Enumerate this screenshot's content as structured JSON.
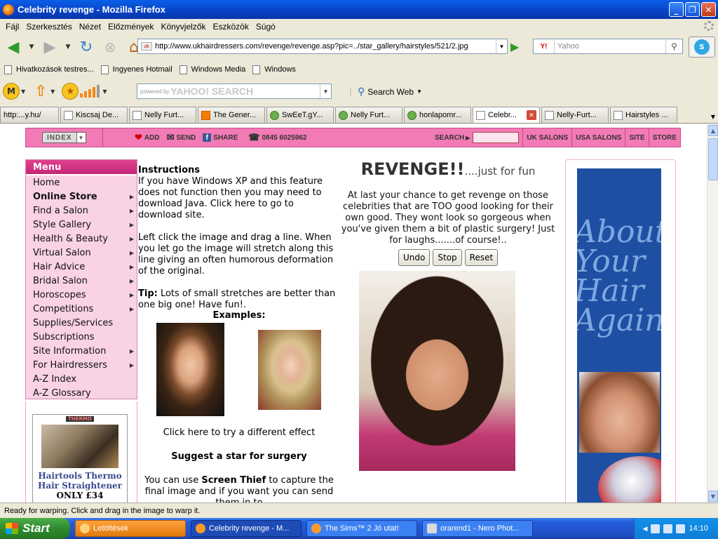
{
  "window": {
    "title": "Celebrity revenge - Mozilla Firefox",
    "buttons": [
      "_",
      "❐",
      "✕"
    ]
  },
  "menubar": {
    "items": [
      "Fájl",
      "Szerkesztés",
      "Nézet",
      "Előzmények",
      "Könyvjelzők",
      "Eszközök",
      "Súgó"
    ]
  },
  "navbar": {
    "url": "http://www.ukhairdressers.com/revenge/revenge.asp?pic=../star_gallery/hairstyles/521/2.jpg",
    "search_placeholder": "Yahoo",
    "search_engine": "Y!"
  },
  "bookmarks": [
    "Hivatkozások testres...",
    "Ingyenes Hotmail",
    "Windows Media",
    "Windows"
  ],
  "yahoo_toolbar": {
    "search_prefix": "powered by",
    "search_logo": "YAHOO! SEARCH",
    "search_web_label": "Search Web"
  },
  "tabs": [
    {
      "label": "http:...y.hu/",
      "icon": "page"
    },
    {
      "label": "Kiscsaj De...",
      "icon": "page"
    },
    {
      "label": "Nelly Furt...",
      "icon": "page"
    },
    {
      "label": "The Gener...",
      "icon": "blogger"
    },
    {
      "label": "SwEeT.gY...",
      "icon": "flower"
    },
    {
      "label": "Nelly Furt...",
      "icon": "flower"
    },
    {
      "label": "honlapomr...",
      "icon": "flower"
    },
    {
      "label": "Celebr...",
      "icon": "page",
      "active": true
    },
    {
      "label": "Nelly-Furt...",
      "icon": "page"
    },
    {
      "label": "Hairstyles ...",
      "icon": "page"
    }
  ],
  "site_nav": {
    "index_label": "INDEX",
    "add": "ADD",
    "send": "SEND",
    "share": "SHARE",
    "phone": "0845 6025962",
    "search_label": "SEARCH",
    "links": [
      "UK SALONS",
      "USA SALONS",
      "SITE",
      "STORE"
    ]
  },
  "menu": {
    "header": "Menu",
    "items": [
      {
        "label": "Home",
        "arrow": false,
        "bold": false
      },
      {
        "label": "Online Store",
        "arrow": true,
        "bold": true
      },
      {
        "label": "Find a Salon",
        "arrow": true,
        "bold": false
      },
      {
        "label": "Style Gallery",
        "arrow": true,
        "bold": false
      },
      {
        "label": "Health & Beauty",
        "arrow": true,
        "bold": false
      },
      {
        "label": "Virtual Salon",
        "arrow": true,
        "bold": false
      },
      {
        "label": "Hair Advice",
        "arrow": true,
        "bold": false
      },
      {
        "label": "Bridal Salon",
        "arrow": true,
        "bold": false
      },
      {
        "label": "Horoscopes",
        "arrow": true,
        "bold": false
      },
      {
        "label": "Competitions",
        "arrow": true,
        "bold": false
      },
      {
        "label": "Supplies/Services",
        "arrow": false,
        "bold": false
      },
      {
        "label": "Subscriptions",
        "arrow": false,
        "bold": false
      },
      {
        "label": "Site Information",
        "arrow": true,
        "bold": false
      },
      {
        "label": "For Hairdressers",
        "arrow": true,
        "bold": false
      },
      {
        "label": "A-Z Index",
        "arrow": false,
        "bold": false
      },
      {
        "label": "A-Z Glossary",
        "arrow": false,
        "bold": false
      }
    ]
  },
  "promo": {
    "brand": "THERMO",
    "title": "Hairtools Thermo Hair Straightener",
    "price": "ONLY £34"
  },
  "instructions": {
    "heading": "Instructions",
    "p1": "If you have Windows XP and this feature does not function then you may need to download Java. Click here to go to download site.",
    "p2": "Left click the image and drag a line. When you let go the image will stretch along this line giving an often humorous deformation of the original.",
    "tip_label": "Tip:",
    "tip_text": " Lots of small stretches are better than one big one! Have fun!.",
    "examples_title": "Examples:",
    "different_effect": "Click here to try a different effect",
    "suggest": "Suggest a star for surgery",
    "screen_thief_pre": "You can use ",
    "screen_thief_bold": "Screen Thief",
    "screen_thief_post": " to capture the final image and if you want you can send them in to"
  },
  "revenge": {
    "title": "REVENGE!!",
    "subtitle": "....just for fun",
    "description": "At last your chance to get revenge on those celebrities that are TOO good looking for their own good. They wont look so gorgeous when you've given them a bit of plastic surgery! Just for laughs.......of course!..",
    "buttons": [
      "Undo",
      "Stop",
      "Reset"
    ]
  },
  "right_ad": {
    "text": "About Your Hair Again"
  },
  "status": "Ready for warping. Click and drag in the image to warp it.",
  "taskbar": {
    "start": "Start",
    "items": [
      {
        "label": "Letöltések",
        "style": "orange"
      },
      {
        "label": "Celebrity revenge - M...",
        "style": "active"
      },
      {
        "label": "The Sims™ 2 Jó utat!",
        "style": "normal"
      },
      {
        "label": "orarend1 - Nero Phot...",
        "style": "normal"
      }
    ],
    "clock": "14:10"
  }
}
